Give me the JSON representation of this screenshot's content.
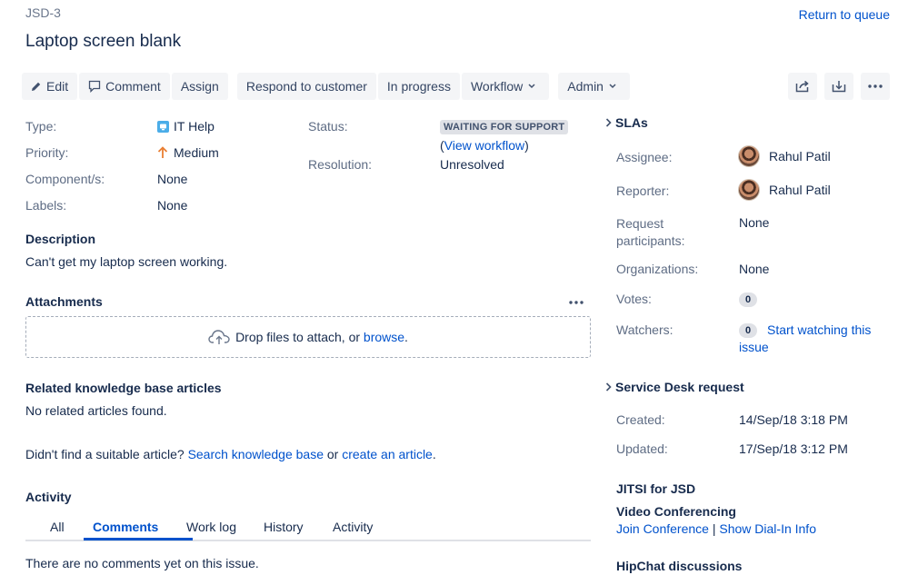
{
  "header": {
    "issue_key": "JSD-3",
    "return_link": "Return to queue",
    "summary": "Laptop screen blank"
  },
  "toolbar": {
    "edit": "Edit",
    "comment": "Comment",
    "assign": "Assign",
    "respond": "Respond to customer",
    "in_progress": "In progress",
    "workflow": "Workflow",
    "admin": "Admin"
  },
  "details": {
    "type_label": "Type:",
    "type_value": "IT Help",
    "priority_label": "Priority:",
    "priority_value": "Medium",
    "component_label": "Component/s:",
    "component_value": "None",
    "labels_label": "Labels:",
    "labels_value": "None",
    "status_label": "Status:",
    "status_value": "WAITING FOR SUPPORT",
    "view_workflow_open": "(",
    "view_workflow": "View workflow",
    "view_workflow_close": ")",
    "resolution_label": "Resolution:",
    "resolution_value": "Unresolved"
  },
  "description": {
    "title": "Description",
    "text": "Can't get my laptop screen working."
  },
  "attachments": {
    "title": "Attachments",
    "drop_text": "Drop files to attach, or ",
    "browse": "browse",
    "period": "."
  },
  "kb": {
    "title": "Related knowledge base articles",
    "none_found": "No related articles found.",
    "prompt": "Didn't find a suitable article? ",
    "search_link": "Search knowledge base",
    "or": " or ",
    "create_link": "create an article",
    "period": "."
  },
  "activity": {
    "title": "Activity",
    "tabs": [
      "All",
      "Comments",
      "Work log",
      "History",
      "Activity"
    ],
    "active_tab": "Comments",
    "empty": "There are no comments yet on this issue."
  },
  "sidebar": {
    "slas_title": "SLAs",
    "assignee_label": "Assignee:",
    "assignee_value": "Rahul Patil",
    "reporter_label": "Reporter:",
    "reporter_value": "Rahul Patil",
    "participants_label_1": "Request",
    "participants_label_2": "participants:",
    "participants_value": "None",
    "organizations_label": "Organizations:",
    "organizations_value": "None",
    "votes_label": "Votes:",
    "votes_value": "0",
    "watchers_label": "Watchers:",
    "watchers_value": "0",
    "watch_link_1": "Start watching this",
    "watch_link_2": "issue",
    "sd_title": "Service Desk request",
    "created_label": "Created:",
    "created_value": "14/Sep/18 3:18 PM",
    "updated_label": "Updated:",
    "updated_value": "17/Sep/18 3:12 PM",
    "jitsi_title": "JITSI for JSD",
    "video_title": "Video Conferencing",
    "join_link": "Join Conference",
    "separator": " | ",
    "dialin_link": "Show Dial-In Info",
    "hipchat_title": "HipChat discussions"
  },
  "colors": {
    "link": "#0052cc",
    "text": "#172b4d",
    "muted": "#5e6c84",
    "button_bg": "#f4f5f7",
    "lozenge_bg": "#dfe1e6",
    "priority_medium": "#e97f33",
    "type_icon": "#4bade8"
  }
}
